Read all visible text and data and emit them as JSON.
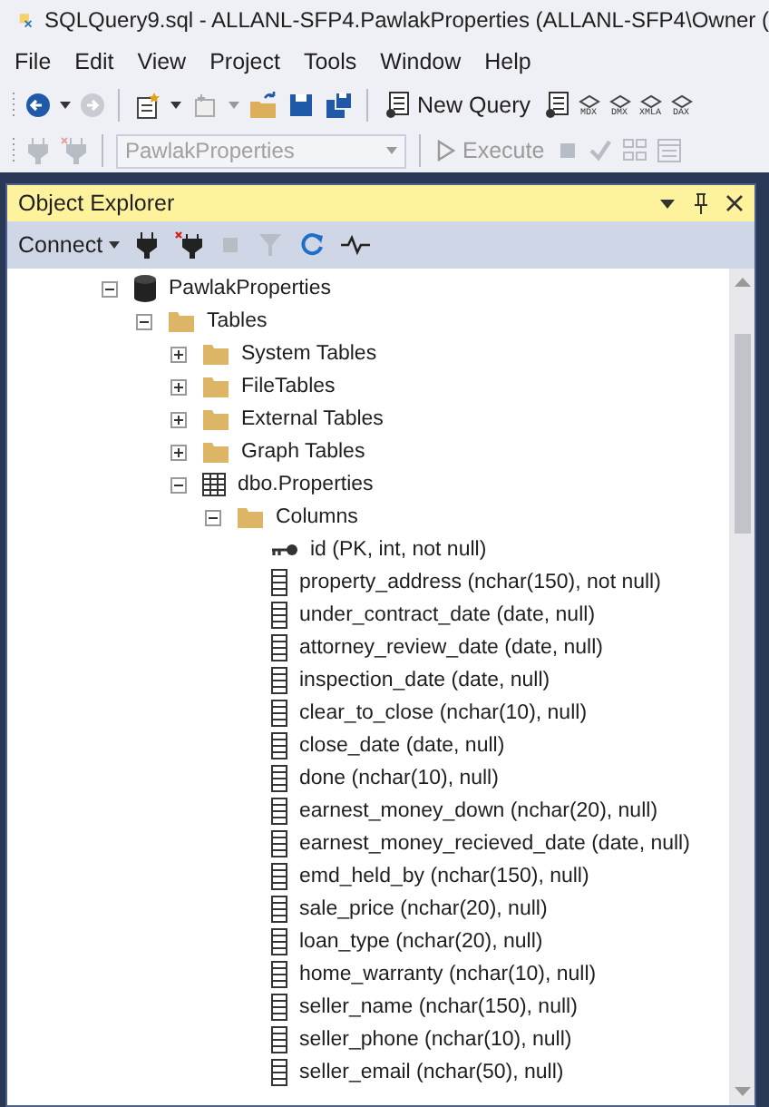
{
  "window": {
    "title": "SQLQuery9.sql - ALLANL-SFP4.PawlakProperties (ALLANL-SFP4\\Owner ("
  },
  "menu": [
    "File",
    "Edit",
    "View",
    "Project",
    "Tools",
    "Window",
    "Help"
  ],
  "toolbar": {
    "new_query": "New Query",
    "query_types": [
      "MDX",
      "DMX",
      "XMLA",
      "DAX"
    ]
  },
  "query_toolbar": {
    "database": {
      "value": "PawlakProperties",
      "disabled": true
    },
    "execute": {
      "label": "Execute",
      "disabled": true
    }
  },
  "explorer": {
    "title": "Object Explorer",
    "connect": "Connect",
    "tree": [
      {
        "label": "PawlakProperties",
        "kind": "database",
        "expanded": true,
        "children": [
          {
            "label": "Tables",
            "kind": "folder",
            "expanded": true,
            "children": [
              {
                "label": "System Tables",
                "kind": "folder",
                "expanded": false
              },
              {
                "label": "FileTables",
                "kind": "folder",
                "expanded": false
              },
              {
                "label": "External Tables",
                "kind": "folder",
                "expanded": false
              },
              {
                "label": "Graph Tables",
                "kind": "folder",
                "expanded": false
              },
              {
                "label": "dbo.Properties",
                "kind": "table",
                "expanded": true,
                "children": [
                  {
                    "label": "Columns",
                    "kind": "folder",
                    "expanded": true,
                    "children": [
                      {
                        "label": "id (PK, int, not null)",
                        "kind": "key"
                      },
                      {
                        "label": "property_address (nchar(150), not null)",
                        "kind": "column"
                      },
                      {
                        "label": "under_contract_date (date, null)",
                        "kind": "column"
                      },
                      {
                        "label": "attorney_review_date (date, null)",
                        "kind": "column"
                      },
                      {
                        "label": "inspection_date (date, null)",
                        "kind": "column"
                      },
                      {
                        "label": "clear_to_close (nchar(10), null)",
                        "kind": "column"
                      },
                      {
                        "label": "close_date (date, null)",
                        "kind": "column"
                      },
                      {
                        "label": "done (nchar(10), null)",
                        "kind": "column"
                      },
                      {
                        "label": "earnest_money_down (nchar(20), null)",
                        "kind": "column"
                      },
                      {
                        "label": "earnest_money_recieved_date (date, null)",
                        "kind": "column"
                      },
                      {
                        "label": "emd_held_by (nchar(150), null)",
                        "kind": "column"
                      },
                      {
                        "label": "sale_price (nchar(20), null)",
                        "kind": "column"
                      },
                      {
                        "label": "loan_type (nchar(20), null)",
                        "kind": "column"
                      },
                      {
                        "label": "home_warranty (nchar(10), null)",
                        "kind": "column"
                      },
                      {
                        "label": "seller_name (nchar(150), null)",
                        "kind": "column"
                      },
                      {
                        "label": "seller_phone (nchar(10), null)",
                        "kind": "column"
                      },
                      {
                        "label": "seller_email (nchar(50), null)",
                        "kind": "column"
                      }
                    ]
                  }
                ]
              }
            ]
          }
        ]
      }
    ]
  }
}
